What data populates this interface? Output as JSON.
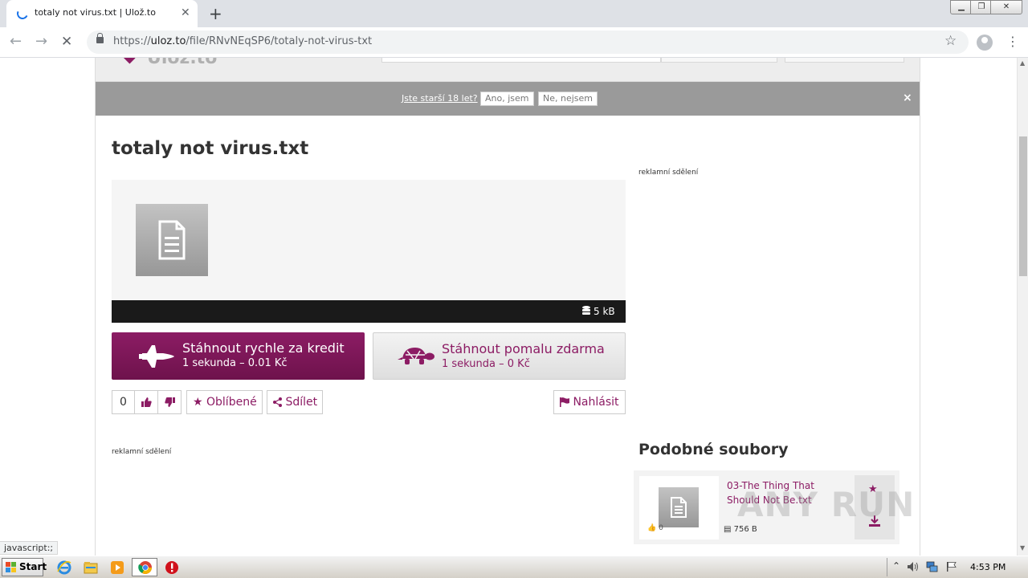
{
  "browser": {
    "tab_title": "totaly not virus.txt | Ulož.to",
    "url_scheme": "https://",
    "url_host": "uloz.to",
    "url_path": "/file/RNvNEqSP6/totaly-not-virus-txt"
  },
  "age_gate": {
    "question": "Jste starší 18 let?",
    "yes_label": "Ano, jsem",
    "no_label": "Ne, nejsem",
    "close_glyph": "×"
  },
  "file": {
    "title": "totaly not virus.txt",
    "size": "5 kB"
  },
  "download": {
    "fast_title": "Stáhnout rychle za kredit",
    "fast_subtitle": "1 sekunda – 0.01 Kč",
    "slow_title": "Stáhnout pomalu zdarma",
    "slow_subtitle": "1 sekunda – 0 Kč"
  },
  "actions": {
    "like_count": "0",
    "favorite_label": "Oblíbené",
    "share_label": "Sdílet",
    "report_label": "Nahlásit"
  },
  "ads": {
    "label": "reklamní sdělení"
  },
  "similar": {
    "heading": "Podobné soubory",
    "items": [
      {
        "name": "03-The Thing That Should Not Be.txt",
        "likes": "0",
        "size": "756 B"
      }
    ]
  },
  "status_bar_text": "javascript:;",
  "watermark": "ANY RUN",
  "taskbar": {
    "start_label": "Start",
    "clock": "4:53 PM"
  },
  "colors": {
    "brand": "#8c1c64",
    "age_bar": "#9a9a9a",
    "info_bar": "#1a1a1a"
  }
}
